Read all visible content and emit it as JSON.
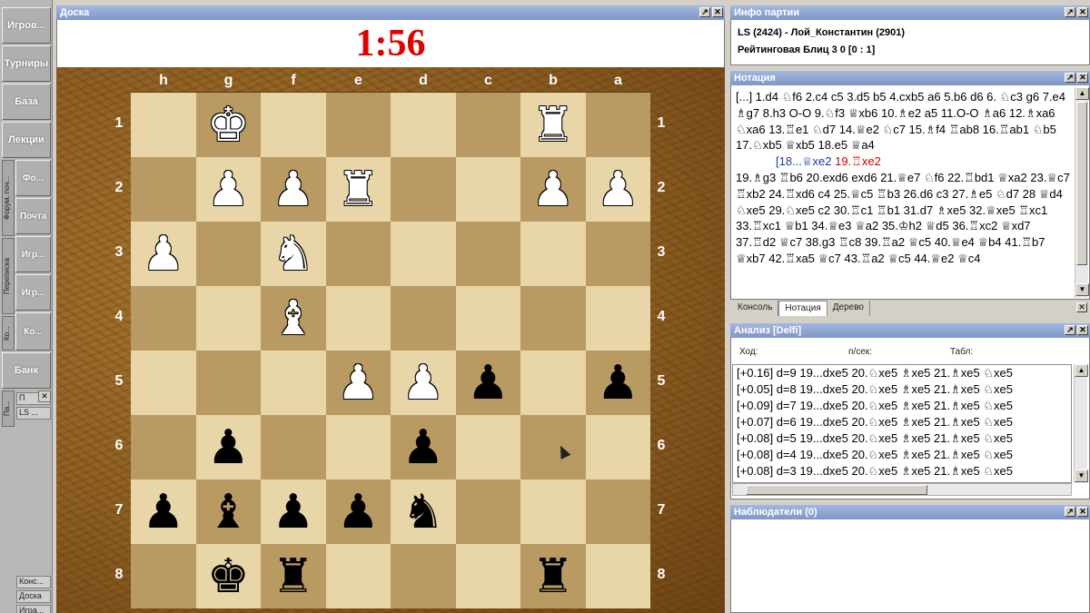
{
  "sidebar": {
    "buttons": [
      "Игров...",
      "Турниры",
      "База",
      "Лекции",
      "Банк"
    ],
    "side_labels": [
      "Форум, поч...",
      "Переписка",
      "Ко..."
    ],
    "sub_buttons": [
      "Фо...",
      "Почта",
      "Игр...",
      "Игр...",
      "Ко..."
    ],
    "side_pa": "Па...",
    "pa_items": [
      "П",
      "LS ..."
    ],
    "bottom_items": [
      "Конс...",
      "Доска",
      "Игра..."
    ]
  },
  "board": {
    "title": "Доска",
    "clock": "1:56",
    "files": [
      "h",
      "g",
      "f",
      "e",
      "d",
      "c",
      "b",
      "a"
    ],
    "ranks": [
      "1",
      "2",
      "3",
      "4",
      "5",
      "6",
      "7",
      "8"
    ],
    "rows": [
      [
        "",
        "wK",
        "",
        "",
        "",
        "",
        "wR",
        ""
      ],
      [
        "",
        "wP",
        "wP",
        "wR",
        "",
        "",
        "wP",
        "wP"
      ],
      [
        "wP",
        "",
        "wN",
        "",
        "",
        "",
        "",
        ""
      ],
      [
        "",
        "",
        "wB",
        "",
        "",
        "",
        "",
        ""
      ],
      [
        "",
        "",
        "",
        "wP",
        "wP",
        "bP",
        "",
        "bP"
      ],
      [
        "",
        "bP",
        "",
        "",
        "bP",
        "",
        "",
        ""
      ],
      [
        "bP",
        "bB",
        "bP",
        "bP",
        "bN",
        "",
        "",
        ""
      ],
      [
        "",
        "bK",
        "bR",
        "",
        "",
        "",
        "bR",
        ""
      ]
    ]
  },
  "game_info": {
    "title": "Инфо партии",
    "players": "LS (2424) - Лой_Константин (2901)",
    "event": "Рейтинговая Блиц 3 0 [0 : 1]"
  },
  "notation": {
    "title": "Нотация",
    "main": "[...] 1.d4 ♘f6 2.c4 c5 3.d5 b5 4.cxb5 a6 5.b6 d6 6. ♘c3 g6 7.e4 ♗g7 8.h3 O-O 9.♘f3 ♕xb6 10.♗e2 a5 11.O-O ♗a6 12.♗xa6 ♘xa6 13.♖e1 ♘d7 14.♕e2 ♘c7 15.♗f4 ♖ab8 16.♖ab1 ♘b5 17.♘xb5 ♕xb5 18.e5 ♕a4",
    "variation_blue": "[18...♕xe2",
    "variation_red": "19.♖xe2",
    "rest": "19.♗g3 ♖b6 20.exd6 exd6 21.♕e7 ♘f6 22.♖bd1 ♕xa2 23.♕c7 ♖xb2 24.♖xd6 c4 25.♕c5 ♖b3 26.d6 c3 27.♗e5 ♘d7 28 ♕d4 ♘xe5 29.♘xe5 c2 30.♖c1 ♖b1 31.d7 ♗xe5 32.♕xe5 ♖xc1 33.♖xc1 ♕b1 34.♕e3 ♕a2 35.♔h2 ♕d5 36.♖xc2 ♕xd7 37.♖d2 ♕c7 38.g3 ♖c8 39.♖a2 ♕c5 40.♕e4 ♕b4 41.♖b7 ♕xb7 42.♖xa5 ♕c7 43.♖a2 ♕c5 44.♕e2 ♕c4"
  },
  "tabs": [
    "Консоль",
    "Нотация",
    "Дерево"
  ],
  "analysis": {
    "title": "Анализ [Delfi]",
    "headers": [
      "Ход:",
      "п/сек:",
      "Табл:"
    ],
    "lines": [
      "[+0.16] d=9 19...dxe5 20.♘xe5 ♗xe5 21.♗xe5 ♘xe5",
      "[+0.05] d=8 19...dxe5 20.♘xe5 ♗xe5 21.♗xe5 ♘xe5",
      "[+0.09] d=7 19...dxe5 20.♘xe5 ♗xe5 21.♗xe5 ♘xe5",
      "[+0.07] d=6 19...dxe5 20.♘xe5 ♗xe5 21.♗xe5 ♘xe5",
      "[+0.08] d=5 19...dxe5 20.♘xe5 ♗xe5 21.♗xe5 ♘xe5",
      "[+0.08] d=4 19...dxe5 20.♘xe5 ♗xe5 21.♗xe5 ♘xe5",
      "[+0.08] d=3 19...dxe5 20.♘xe5 ♗xe5 21.♗xe5 ♘xe5"
    ]
  },
  "observers": {
    "title": "Наблюдатели (0)"
  },
  "colors": {
    "clock": "#e00000",
    "title_bar": "#8da4d4",
    "light_square": "#e8d6a8",
    "dark_square": "#b99a63"
  }
}
